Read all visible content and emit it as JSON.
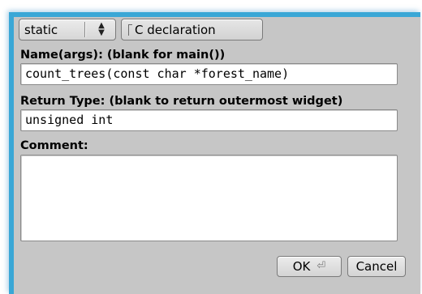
{
  "dialog": {
    "visibility_choice": {
      "value": "static"
    },
    "c_declaration": {
      "label": "C declaration",
      "checked": false
    },
    "name": {
      "label": "Name(args): (blank for main())",
      "value": "count_trees(const char *forest_name)"
    },
    "return_type": {
      "label": "Return Type: (blank to return outermost widget)",
      "value": "unsigned int"
    },
    "comment": {
      "label": "Comment:",
      "value": ""
    },
    "ok_label": "OK",
    "cancel_label": "Cancel",
    "icons": {
      "choice_arrows": "up-down-arrows-icon",
      "ok_shortcut": "return-key-icon"
    },
    "colors": {
      "window_border": "#3aa7d6",
      "background": "#c6c6c6"
    }
  }
}
